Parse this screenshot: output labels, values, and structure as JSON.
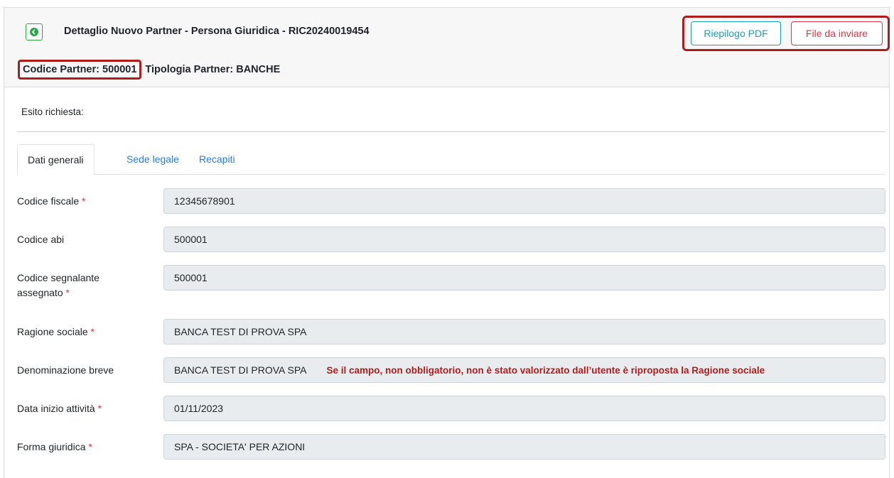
{
  "header": {
    "title": "Dettaglio Nuovo Partner - Persona Giuridica - RIC20240019454",
    "codice_partner": "Codice Partner: 500001",
    "tipologia_partner": "Tipologia Partner: BANCHE",
    "buttons": {
      "pdf": "Riepilogo PDF",
      "file": "File da inviare"
    }
  },
  "esito": "Esito richiesta:",
  "tabs": [
    "Dati generali",
    "Sede legale",
    "Recapiti"
  ],
  "fields": [
    {
      "label": "Codice fiscale",
      "required": "*",
      "value": "12345678901"
    },
    {
      "label": "Codice abi",
      "required": "",
      "value": "500001"
    },
    {
      "label": "Codice segnalante",
      "label2": "assegnato",
      "required": "*",
      "value": "500001"
    },
    {
      "label": "Ragione sociale",
      "required": "*",
      "value": "BANCA TEST DI PROVA SPA"
    },
    {
      "label": "Denominazione breve",
      "required": "",
      "value": "BANCA TEST DI PROVA SPA",
      "note": "Se il campo, non obbligatorio, non è stato valorizzato dall’utente è riproposta la Ragione sociale"
    },
    {
      "label": "Data inizio attività",
      "required": "*",
      "value": "01/11/2023"
    },
    {
      "label": "Forma giuridica",
      "required": "*",
      "value": "SPA - SOCIETA' PER AZIONI"
    }
  ],
  "colors": {
    "accent_green": "#28a745",
    "info": "#17a2b8",
    "danger": "#dc3545",
    "highlight": "#b01c1c"
  }
}
